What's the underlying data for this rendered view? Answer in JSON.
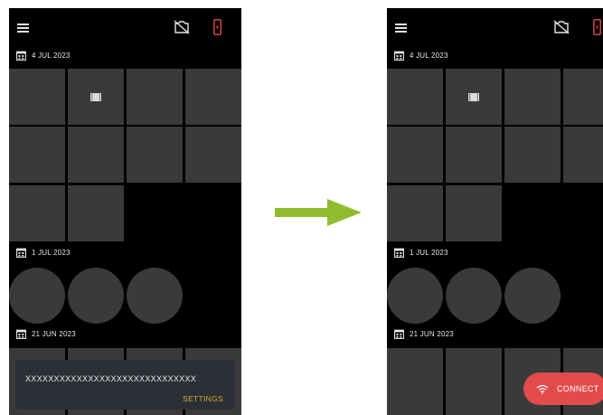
{
  "colors": {
    "background": "#000000",
    "tile": "#3a3a3a",
    "snackbar": "#2b3036",
    "snackbar_action": "#d6a92a",
    "connect_button": "#e24b4b",
    "phone_icon": "#e24b4b",
    "arrow": "#8fbd2e"
  },
  "icons": {
    "menu": "hamburger-menu",
    "camera": "camera-off",
    "device": "phone",
    "date": "calendar",
    "video": "film",
    "connect": "wifi",
    "transition": "right-arrow"
  },
  "before": {
    "sections": [
      {
        "date": "4 JUL 2023"
      },
      {
        "date": "1 JUL 2023"
      },
      {
        "date": "21 JUN 2023"
      }
    ],
    "snackbar": {
      "message": "XXXXXXXXXXXXXXXXXXXXXXXXXXXXXX",
      "action": "SETTINGS"
    }
  },
  "after": {
    "sections": [
      {
        "date": "4 JUL 2023"
      },
      {
        "date": "1 JUL 2023"
      },
      {
        "date": "21 JUN 2023"
      }
    ],
    "connect_button": {
      "label": "CONNECT"
    }
  }
}
